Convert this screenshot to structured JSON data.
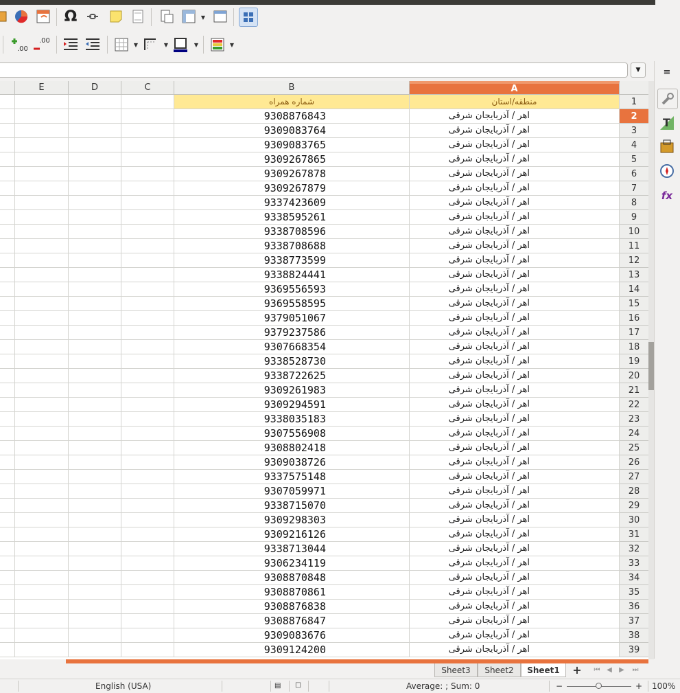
{
  "toolbar": {
    "row1": [
      "chart-icon",
      "pivot-table-icon",
      "special-character-icon",
      "hyperlink-icon",
      "comment-icon",
      "header-footer-icon",
      "define-print-area-icon",
      "freeze-rows-columns-icon",
      "split-window-icon",
      "show-draw-functions-icon"
    ],
    "special_char_glyph": "Ω",
    "row2": [
      "add-decimal-icon",
      "delete-decimal-icon",
      "increase-indent-icon",
      "decrease-indent-icon",
      "toggle-grid-icon",
      "borders-icon",
      "border-style-icon",
      "border-color-icon",
      "conditional-icon"
    ],
    "add_decimal_text": ".00",
    "delete_decimal_text": ".00"
  },
  "columns": [
    {
      "id": "E",
      "label": "E"
    },
    {
      "id": "D",
      "label": "D"
    },
    {
      "id": "C",
      "label": "C"
    },
    {
      "id": "B",
      "label": "B"
    },
    {
      "id": "A",
      "label": "A"
    }
  ],
  "header_row": {
    "num": "1",
    "a": "منطقه/استان",
    "b": "شماره همراه"
  },
  "active_row": "2",
  "rows": [
    {
      "num": "2",
      "a": "اهر / آذربایجان شرقی",
      "b": "9308876843"
    },
    {
      "num": "3",
      "a": "اهر / آذربایجان شرقی",
      "b": "9309083764"
    },
    {
      "num": "4",
      "a": "اهر / آذربایجان شرقی",
      "b": "9309083765"
    },
    {
      "num": "5",
      "a": "اهر / آذربایجان شرقی",
      "b": "9309267865"
    },
    {
      "num": "6",
      "a": "اهر / آذربایجان شرقی",
      "b": "9309267878"
    },
    {
      "num": "7",
      "a": "اهر / آذربایجان شرقی",
      "b": "9309267879"
    },
    {
      "num": "8",
      "a": "اهر / آذربایجان شرقی",
      "b": "9337423609"
    },
    {
      "num": "9",
      "a": "اهر / آذربایجان شرقی",
      "b": "9338595261"
    },
    {
      "num": "10",
      "a": "اهر / آذربایجان شرقی",
      "b": "9338708596"
    },
    {
      "num": "11",
      "a": "اهر / آذربایجان شرقی",
      "b": "9338708688"
    },
    {
      "num": "12",
      "a": "اهر / آذربایجان شرقی",
      "b": "9338773599"
    },
    {
      "num": "13",
      "a": "اهر / آذربایجان شرقی",
      "b": "9338824441"
    },
    {
      "num": "14",
      "a": "اهر / آذربایجان شرقی",
      "b": "9369556593"
    },
    {
      "num": "15",
      "a": "اهر / آذربایجان شرقی",
      "b": "9369558595"
    },
    {
      "num": "16",
      "a": "اهر / آذربایجان شرقی",
      "b": "9379051067"
    },
    {
      "num": "17",
      "a": "اهر / آذربایجان شرقی",
      "b": "9379237586"
    },
    {
      "num": "18",
      "a": "اهر / آذربایجان شرقی",
      "b": "9307668354"
    },
    {
      "num": "19",
      "a": "اهر / آذربایجان شرقی",
      "b": "9338528730"
    },
    {
      "num": "20",
      "a": "اهر / آذربایجان شرقی",
      "b": "9338722625"
    },
    {
      "num": "21",
      "a": "اهر / آذربایجان شرقی",
      "b": "9309261983"
    },
    {
      "num": "22",
      "a": "اهر / آذربایجان شرقی",
      "b": "9309294591"
    },
    {
      "num": "23",
      "a": "اهر / آذربایجان شرقی",
      "b": "9338035183"
    },
    {
      "num": "24",
      "a": "اهر / آذربایجان شرقی",
      "b": "9307556908"
    },
    {
      "num": "25",
      "a": "اهر / آذربایجان شرقی",
      "b": "9308802418"
    },
    {
      "num": "26",
      "a": "اهر / آذربایجان شرقی",
      "b": "9309038726"
    },
    {
      "num": "27",
      "a": "اهر / آذربایجان شرقی",
      "b": "9337575148"
    },
    {
      "num": "28",
      "a": "اهر / آذربایجان شرقی",
      "b": "9307059971"
    },
    {
      "num": "29",
      "a": "اهر / آذربایجان شرقی",
      "b": "9338715070"
    },
    {
      "num": "30",
      "a": "اهر / آذربایجان شرقی",
      "b": "9309298303"
    },
    {
      "num": "31",
      "a": "اهر / آذربایجان شرقی",
      "b": "9309216126"
    },
    {
      "num": "32",
      "a": "اهر / آذربایجان شرقی",
      "b": "9338713044"
    },
    {
      "num": "33",
      "a": "اهر / آذربایجان شرقی",
      "b": "9306234119"
    },
    {
      "num": "34",
      "a": "اهر / آذربایجان شرقی",
      "b": "9308870848"
    },
    {
      "num": "35",
      "a": "اهر / آذربایجان شرقی",
      "b": "9308870861"
    },
    {
      "num": "36",
      "a": "اهر / آذربایجان شرقی",
      "b": "9308876838"
    },
    {
      "num": "37",
      "a": "اهر / آذربایجان شرقی",
      "b": "9308876847"
    },
    {
      "num": "38",
      "a": "اهر / آذربایجان شرقی",
      "b": "9309083676"
    },
    {
      "num": "39",
      "a": "اهر / آذربایجان شرقی",
      "b": "9309124200"
    }
  ],
  "sheet_tabs": [
    {
      "label": "Sheet3",
      "active": false
    },
    {
      "label": "Sheet2",
      "active": false
    },
    {
      "label": "Sheet1",
      "active": true
    }
  ],
  "add_sheet_glyph": "+",
  "status": {
    "language": "English (USA)",
    "summary": "Average: ; Sum: 0",
    "zoom_minus": "−",
    "zoom_plus": "+",
    "zoom": "100%"
  },
  "sidebar": [
    "properties-icon",
    "styles-icon",
    "gallery-icon",
    "navigator-icon",
    "functions-icon"
  ],
  "sidebar_menu_glyph": "≡",
  "colors": {
    "accent": "#e8733e",
    "header_fill": "#ffe994",
    "header_text": "#8a5a10",
    "grid_line": "#d4d4d0"
  }
}
